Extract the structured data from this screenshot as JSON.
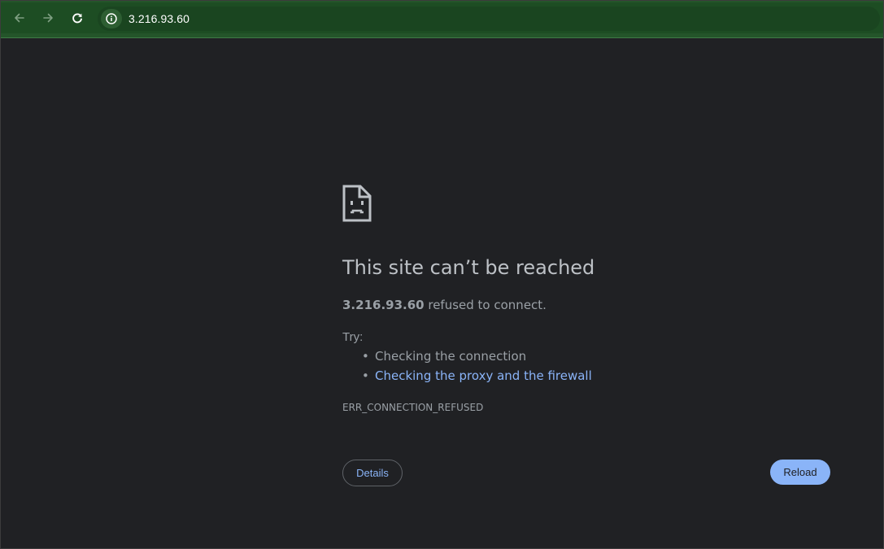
{
  "browser": {
    "url": "3.216.93.60",
    "icons": {
      "back": "arrow-left-icon",
      "forward": "arrow-right-icon",
      "reload": "reload-icon",
      "site_info": "info-icon"
    },
    "colors": {
      "toolbar": "#1d4d23",
      "page_background": "#202124"
    }
  },
  "error_page": {
    "icon": "sad-page-icon",
    "title": "This site can’t be reached",
    "host": "3.216.93.60",
    "message": " refused to connect.",
    "try_label": "Try:",
    "suggestions": [
      {
        "label": "Checking the connection",
        "link": false
      },
      {
        "label": "Checking the proxy and the firewall",
        "link": true
      }
    ],
    "error_code": "ERR_CONNECTION_REFUSED",
    "details_label": "Details",
    "reload_label": "Reload",
    "colors": {
      "accent": "#8ab4f8",
      "text": "#9aa0a6",
      "heading": "#bdc1c6"
    }
  }
}
